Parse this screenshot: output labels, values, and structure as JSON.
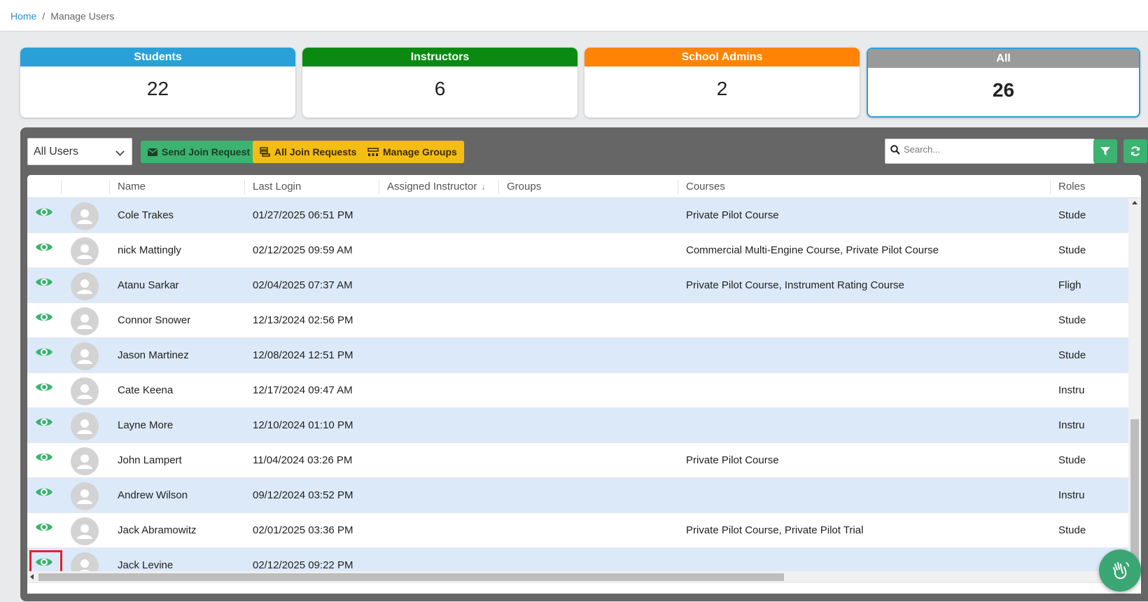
{
  "breadcrumb": {
    "home": "Home",
    "separator": "/",
    "current": "Manage Users"
  },
  "cards": [
    {
      "label": "Students",
      "count": "22",
      "color": "#2aa0d8"
    },
    {
      "label": "Instructors",
      "count": "6",
      "color": "#0b8a12"
    },
    {
      "label": "School Admins",
      "count": "2",
      "color": "#ff8406"
    },
    {
      "label": "All",
      "count": "26",
      "color": "#9a9a9a"
    }
  ],
  "toolbar": {
    "filter_select": "All Users",
    "send_join_request": "Send Join Request",
    "all_join_requests": "All Join Requests",
    "manage_groups": "Manage Groups",
    "search_placeholder": "Search..."
  },
  "table": {
    "columns": {
      "name": "Name",
      "last_login": "Last Login",
      "assigned_instructor": "Assigned Instructor",
      "sort_indicator": "↓",
      "groups": "Groups",
      "courses": "Courses",
      "roles": "Roles"
    },
    "rows": [
      {
        "name": "Cole Trakes",
        "last_login": "01/27/2025 06:51 PM",
        "courses": "Private Pilot Course",
        "role": "Stude"
      },
      {
        "name": "nick Mattingly",
        "last_login": "02/12/2025 09:59 AM",
        "courses": "Commercial Multi-Engine Course, Private Pilot Course",
        "role": "Stude"
      },
      {
        "name": "Atanu Sarkar",
        "last_login": "02/04/2025 07:37 AM",
        "courses": "Private Pilot Course, Instrument Rating Course",
        "role": "Fligh"
      },
      {
        "name": "Connor Snower",
        "last_login": "12/13/2024 02:56 PM",
        "courses": "",
        "role": "Stude"
      },
      {
        "name": "Jason Martinez",
        "last_login": "12/08/2024 12:51 PM",
        "courses": "",
        "role": "Stude"
      },
      {
        "name": "Cate Keena",
        "last_login": "12/17/2024 09:47 AM",
        "courses": "",
        "role": "Instru"
      },
      {
        "name": "Layne More",
        "last_login": "12/10/2024 01:10 PM",
        "courses": "",
        "role": "Instru"
      },
      {
        "name": "John Lampert",
        "last_login": "11/04/2024 03:26 PM",
        "courses": "Private Pilot Course",
        "role": "Stude"
      },
      {
        "name": "Andrew Wilson",
        "last_login": "09/12/2024 03:52 PM",
        "courses": "",
        "role": "Instru"
      },
      {
        "name": "Jack Abramowitz",
        "last_login": "02/01/2025 03:36 PM",
        "courses": "Private Pilot Course, Private Pilot Trial",
        "role": "Stude"
      },
      {
        "name": "Jack Levine",
        "last_login": "02/12/2025 09:22 PM",
        "courses": "",
        "role": ""
      }
    ]
  },
  "colors": {
    "accent_green": "#3cb371",
    "accent_yellow": "#f4bd15",
    "row_alt": "#dce9f8",
    "highlight": "#e0242d"
  },
  "icons": {
    "view": "eye-icon",
    "avatar": "user-avatar-icon",
    "filter": "filter-icon",
    "refresh": "refresh-icon",
    "help": "waving-hand-icon"
  }
}
